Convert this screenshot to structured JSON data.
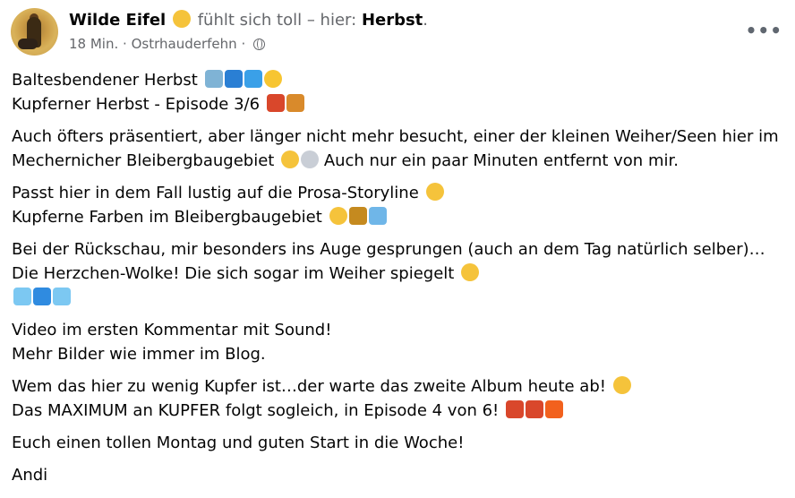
{
  "post": {
    "author": "Wilde Eifel",
    "feeling_prefix": "fühlt sich toll – hier:",
    "feeling_place": "Herbst",
    "feeling_suffix": ".",
    "time": "18 Min.",
    "separator": "·",
    "location": "Ostrhauderfehn",
    "more_label": "•••",
    "icons": {
      "avatar": "avatar-photo",
      "feeling": "smiling-face-emoji",
      "audience": "globe-icon",
      "more": "more-options-icon"
    },
    "paragraphs": [
      {
        "lines": [
          {
            "text": "Baltesbendener Herbst",
            "emojis": [
              "house-tree-emoji",
              "wave-emoji",
              "droplet-emoji",
              "sun-emoji"
            ]
          },
          {
            "text": "Kupferner Herbst - Episode 3/6",
            "emojis": [
              "maple-leaf-emoji",
              "fallen-leaf-emoji"
            ]
          }
        ]
      },
      {
        "lines": [
          {
            "text": "Auch öfters präsentiert, aber länger nicht mehr besucht, einer der kleinen Weiher/Seen hier im",
            "emojis": []
          },
          {
            "text": "Mechernicher Bleibergbaugebiet",
            "emojis": [
              "smiling-face-emoji",
              "eye-emoji"
            ],
            "after": "Auch nur ein paar Minuten entfernt von mir."
          }
        ]
      },
      {
        "lines": [
          {
            "text": "Passt hier in dem Fall lustig auf die Prosa-Storyline",
            "emojis": [
              "grinning-face-emoji"
            ]
          },
          {
            "text": "Kupferne Farben im Bleibergbaugebiet",
            "emojis": [
              "partying-face-emoji",
              "landscape-emoji",
              "lake-emoji"
            ]
          }
        ]
      },
      {
        "lines": [
          {
            "text": "Bei der Rückschau, mir besonders ins Auge gesprungen (auch an dem Tag natürlich selber)…",
            "emojis": []
          },
          {
            "text": "Die Herzchen-Wolke! Die sich sogar im Weiher spiegelt",
            "emojis": [
              "star-struck-face-emoji"
            ]
          },
          {
            "text": "",
            "emojis": [
              "light-blue-heart-emoji",
              "blue-heart-emoji",
              "light-blue-heart-emoji"
            ]
          }
        ]
      },
      {
        "lines": [
          {
            "text": "Video im ersten Kommentar mit Sound!",
            "emojis": []
          },
          {
            "text": "Mehr Bilder wie immer im Blog.",
            "emojis": []
          }
        ]
      },
      {
        "lines": [
          {
            "text": "Wem das hier zu wenig Kupfer ist…der warte das zweite Album heute ab!",
            "emojis": [
              "grinning-face-emoji"
            ]
          },
          {
            "text": "Das MAXIMUM an KUPFER folgt sogleich, in Episode 4 von 6!",
            "emojis": [
              "maple-leaf-emoji",
              "cactus-emoji",
              "fire-emoji"
            ]
          }
        ]
      },
      {
        "lines": [
          {
            "text": "Euch einen tollen Montag und guten Start in die Woche!",
            "emojis": []
          }
        ]
      },
      {
        "lines": [
          {
            "text": "Andi",
            "emojis": []
          }
        ]
      }
    ]
  },
  "emoji_colors": {
    "house-tree-emoji": "#7fb3d5",
    "wave-emoji": "#2a7fd4",
    "droplet-emoji": "#3aa0e8",
    "sun-emoji": "#f7c531",
    "maple-leaf-emoji": "#d9472b",
    "fallen-leaf-emoji": "#d98a2b",
    "smiling-face-emoji": "#f5c33b",
    "eye-emoji": "#c9ced6",
    "grinning-face-emoji": "#f5c33b",
    "partying-face-emoji": "#f5c33b",
    "landscape-emoji": "#c58a1f",
    "lake-emoji": "#6fb6e8",
    "star-struck-face-emoji": "#f5c33b",
    "light-blue-heart-emoji": "#7cc8f2",
    "blue-heart-emoji": "#2f8be0",
    "cactus-emoji": "#d9472b",
    "fire-emoji": "#f2611d"
  }
}
